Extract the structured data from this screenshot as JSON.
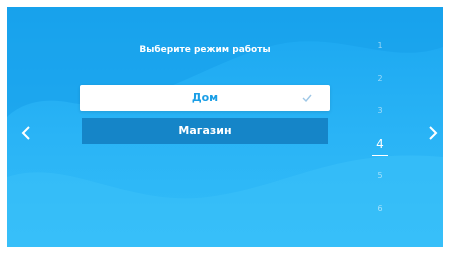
{
  "title": "Выберите режим работы",
  "modes": {
    "selected_label": "Дом",
    "other_label": "Магазин"
  },
  "pages": {
    "items": [
      "1",
      "2",
      "3",
      "4",
      "5",
      "6"
    ],
    "active_index": 3
  },
  "icons": {
    "prev": "chevron-left-icon",
    "next": "chevron-right-icon",
    "check": "check-icon"
  },
  "colors": {
    "background": "#2ab4f6",
    "selected_bg": "#ffffff",
    "selected_text": "#1a9ee6",
    "other_bg": "#1585c8",
    "check": "#9ec7e6"
  }
}
